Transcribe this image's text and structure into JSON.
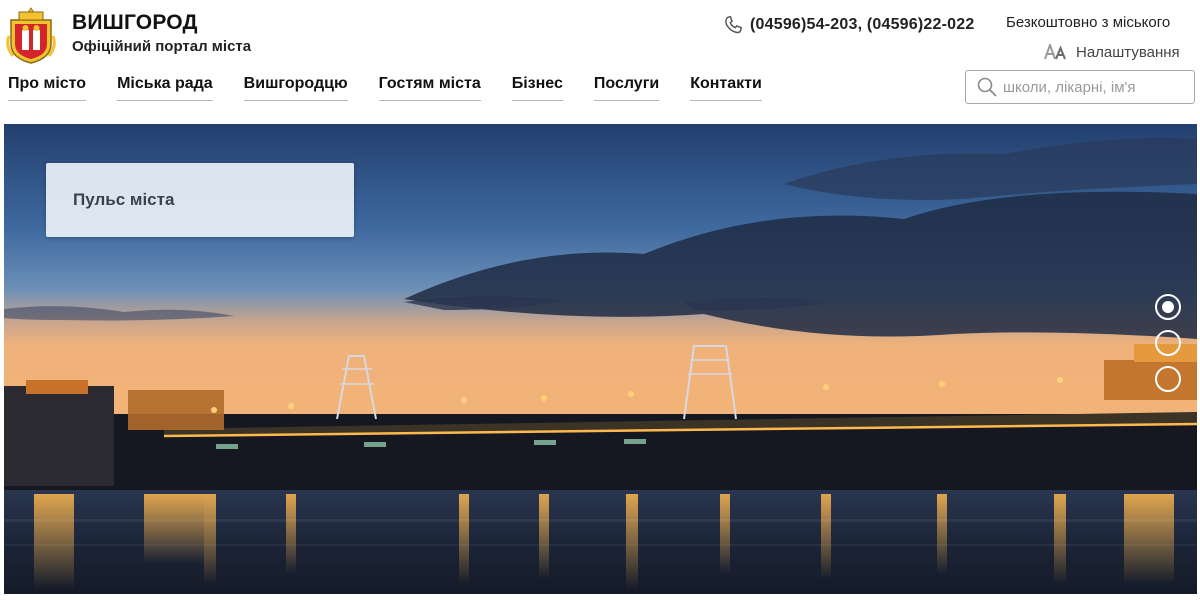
{
  "header": {
    "title": "ВИШГОРОД",
    "subtitle": "Офіційний портал міста",
    "phones": "(04596)54-203,  (04596)22-022",
    "free_note": "Безкоштовно з міського",
    "settings_label": "Налаштування",
    "icons": [
      "coat-of-arms",
      "phone-icon",
      "font-size-icon",
      "search-icon"
    ]
  },
  "nav": {
    "items": [
      {
        "label": "Про місто"
      },
      {
        "label": "Міська рада"
      },
      {
        "label": "Вишгородцю"
      },
      {
        "label": "Гостям міста"
      },
      {
        "label": "Бізнес"
      },
      {
        "label": "Послуги"
      },
      {
        "label": "Контакти"
      }
    ]
  },
  "search": {
    "placeholder": "школи, лікарні, ім'я",
    "value": ""
  },
  "hero": {
    "card_label": "Пульс міста",
    "slides_count": 3,
    "active_slide": 1
  },
  "colors": {
    "sky_top": "#2b4b7e",
    "sky_horizon": "#f0b27a",
    "dam_lights": "#ffb84d",
    "water": "#1b2433"
  }
}
